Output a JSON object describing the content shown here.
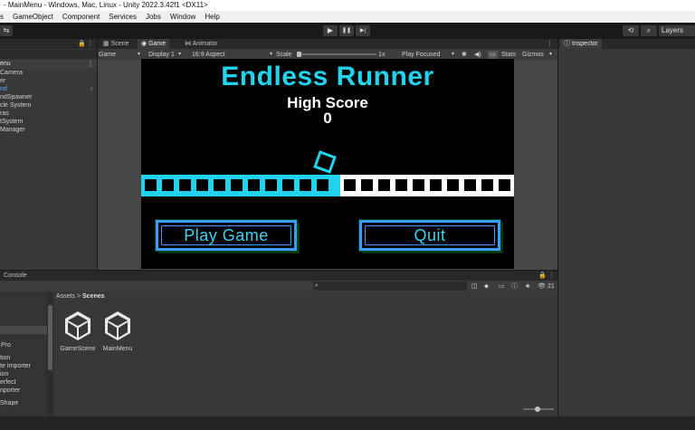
{
  "window": {
    "title": "- MainMenu - Windows, Mac, Linux - Unity 2022.3.42f1 <DX11>"
  },
  "menubar": {
    "items": [
      "s",
      "GameObject",
      "Component",
      "Services",
      "Jobs",
      "Window",
      "Help"
    ]
  },
  "toolbar": {
    "play_icon": "▶",
    "pause_icon": "❚❚",
    "step_icon": "▶|",
    "layers_label": "Layers"
  },
  "hierarchy": {
    "scene_label": "enu",
    "items": [
      "Camera",
      "er",
      "nd",
      "ndSpawner",
      "cle System",
      "ras",
      "tSystem",
      "Manager"
    ]
  },
  "sceneview": {
    "tabs": [
      "Scene",
      "Game",
      "Animator"
    ],
    "controls": {
      "game": "Game",
      "display": "Display 1",
      "aspect": "16:9 Aspect",
      "scale_label": "Scale",
      "scale_value": "1x",
      "play_mode": "Play Focused",
      "stats": "Stats",
      "gizmos": "Gizmos"
    }
  },
  "game": {
    "title": "Endless Runner",
    "high_score_label": "High Score",
    "high_score_value": "0",
    "play_button": "Play Game",
    "quit_button": "Quit"
  },
  "inspector": {
    "tab": "Inspector"
  },
  "console": {
    "tab": "Console",
    "search_count": "21"
  },
  "project": {
    "breadcrumb_root": "Assets",
    "breadcrumb_sep": ">",
    "breadcrumb_current": "Scenes",
    "folders": [
      "Pro",
      "tion",
      "te Importer",
      "ion",
      "erfect",
      "nporter",
      "Shape"
    ],
    "assets": [
      "GameScene",
      "MainMenu"
    ]
  },
  "colors": {
    "accent_cyan": "#22d3ee",
    "button_border": "#3a9cff",
    "panel_bg": "#383838"
  }
}
